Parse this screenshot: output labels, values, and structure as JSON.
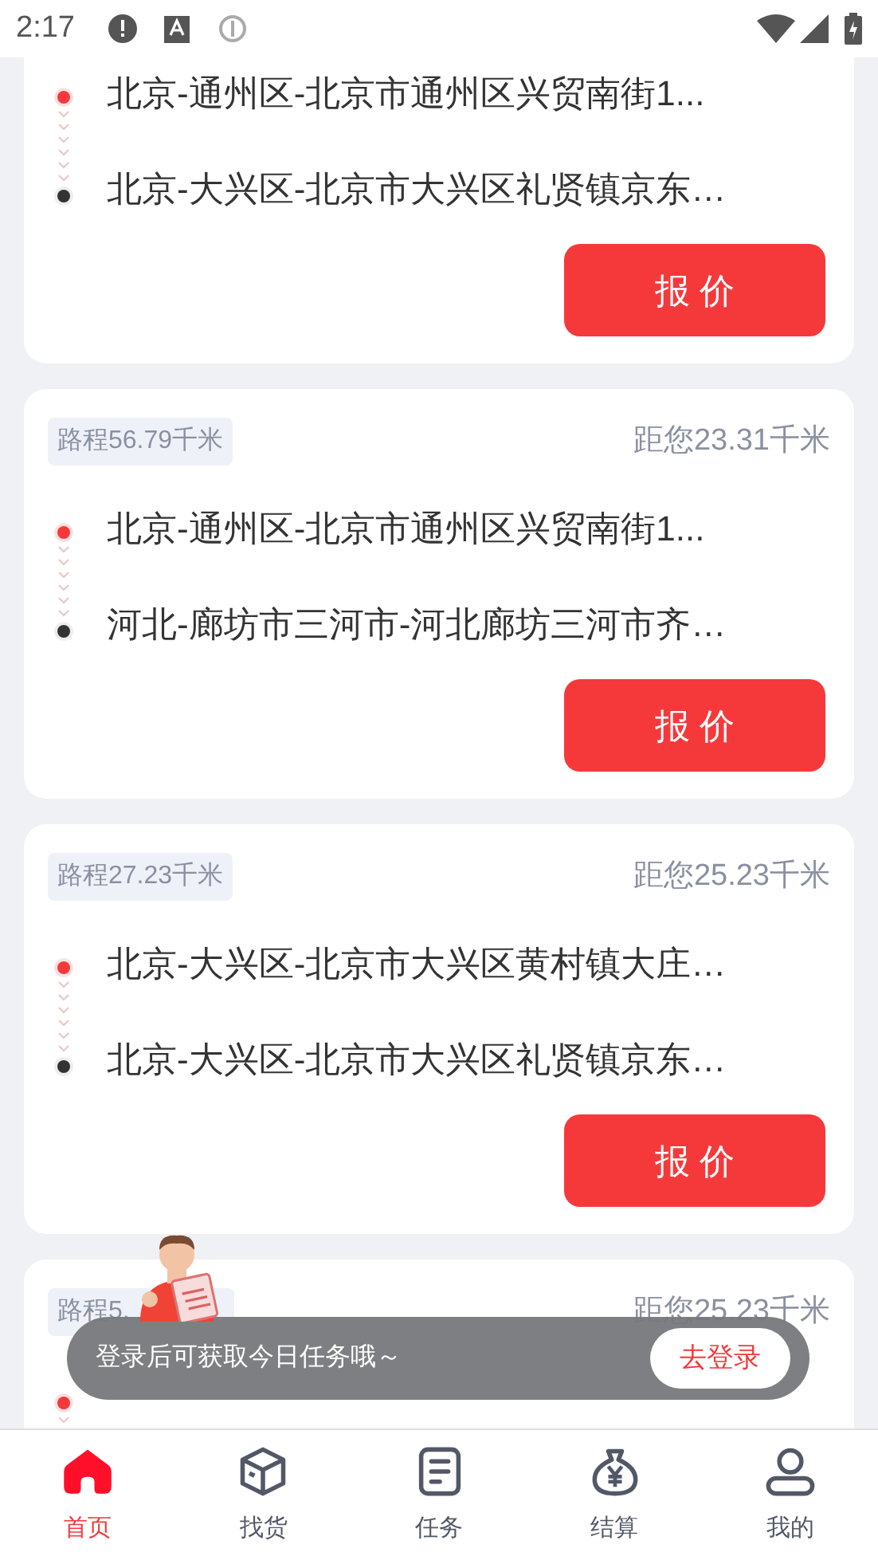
{
  "status_bar": {
    "time": "2:17"
  },
  "orders": [
    {
      "from": "北京-通州区-北京市通州区兴贸南街1...",
      "to": "北京-大兴区-北京市大兴区礼贤镇京东…",
      "button": "报 价"
    },
    {
      "distance_badge": "路程56.79千米",
      "distance_to_you": "距您23.31千米",
      "from": "北京-通州区-北京市通州区兴贸南街1...",
      "to": "河北-廊坊市三河市-河北廊坊三河市齐…",
      "button": "报 价"
    },
    {
      "distance_badge": "路程27.23千米",
      "distance_to_you": "距您25.23千米",
      "from": "北京-大兴区-北京市大兴区黄村镇大庄…",
      "to": "北京-大兴区-北京市大兴区礼贤镇京东…",
      "button": "报 价"
    },
    {
      "distance_badge": "路程5.",
      "distance_to_you": "距您25.23千米"
    }
  ],
  "login_toast": {
    "message": "登录后可获取今日任务哦～",
    "button": "去登录"
  },
  "tab_bar": [
    {
      "kind": "home",
      "label": "首页",
      "selected": true
    },
    {
      "kind": "box",
      "label": "找货",
      "selected": false
    },
    {
      "kind": "task",
      "label": "任务",
      "selected": false
    },
    {
      "kind": "money",
      "label": "结算",
      "selected": false
    },
    {
      "kind": "user",
      "label": "我的",
      "selected": false
    }
  ]
}
